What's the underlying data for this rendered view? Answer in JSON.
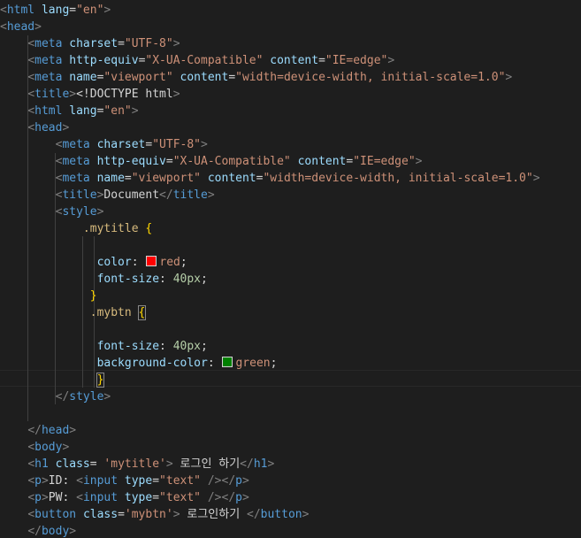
{
  "colors": {
    "swatch_red": "#ff0000",
    "swatch_green": "#008000"
  },
  "lines": [
    [
      [
        "punct",
        "<"
      ],
      [
        "tag",
        "html"
      ],
      [
        "text",
        " "
      ],
      [
        "attr",
        "lang"
      ],
      [
        "text",
        "="
      ],
      [
        "str",
        "\"en\""
      ],
      [
        "punct",
        ">"
      ]
    ],
    [
      [
        "punct",
        "<"
      ],
      [
        "tag",
        "head"
      ],
      [
        "punct",
        ">"
      ]
    ],
    [
      [
        "text",
        "    "
      ],
      [
        "punct",
        "<"
      ],
      [
        "tag",
        "meta"
      ],
      [
        "text",
        " "
      ],
      [
        "attr",
        "charset"
      ],
      [
        "text",
        "="
      ],
      [
        "str",
        "\"UTF-8\""
      ],
      [
        "punct",
        ">"
      ]
    ],
    [
      [
        "text",
        "    "
      ],
      [
        "punct",
        "<"
      ],
      [
        "tag",
        "meta"
      ],
      [
        "text",
        " "
      ],
      [
        "attr",
        "http-equiv"
      ],
      [
        "text",
        "="
      ],
      [
        "str",
        "\"X-UA-Compatible\""
      ],
      [
        "text",
        " "
      ],
      [
        "attr",
        "content"
      ],
      [
        "text",
        "="
      ],
      [
        "str",
        "\"IE=edge\""
      ],
      [
        "punct",
        ">"
      ]
    ],
    [
      [
        "text",
        "    "
      ],
      [
        "punct",
        "<"
      ],
      [
        "tag",
        "meta"
      ],
      [
        "text",
        " "
      ],
      [
        "attr",
        "name"
      ],
      [
        "text",
        "="
      ],
      [
        "str",
        "\"viewport\""
      ],
      [
        "text",
        " "
      ],
      [
        "attr",
        "content"
      ],
      [
        "text",
        "="
      ],
      [
        "str",
        "\"width=device-width, initial-scale=1.0\""
      ],
      [
        "punct",
        ">"
      ]
    ],
    [
      [
        "text",
        "    "
      ],
      [
        "punct",
        "<"
      ],
      [
        "tag",
        "title"
      ],
      [
        "punct",
        ">"
      ],
      [
        "text",
        "<!DOCTYPE html"
      ],
      [
        "punct",
        ">"
      ]
    ],
    [
      [
        "text",
        "    "
      ],
      [
        "punct",
        "<"
      ],
      [
        "tag",
        "html"
      ],
      [
        "text",
        " "
      ],
      [
        "attr",
        "lang"
      ],
      [
        "text",
        "="
      ],
      [
        "str",
        "\"en\""
      ],
      [
        "punct",
        ">"
      ]
    ],
    [
      [
        "text",
        "    "
      ],
      [
        "punct",
        "<"
      ],
      [
        "tag",
        "head"
      ],
      [
        "punct",
        ">"
      ]
    ],
    [
      [
        "text",
        "        "
      ],
      [
        "punct",
        "<"
      ],
      [
        "tag",
        "meta"
      ],
      [
        "text",
        " "
      ],
      [
        "attr",
        "charset"
      ],
      [
        "text",
        "="
      ],
      [
        "str",
        "\"UTF-8\""
      ],
      [
        "punct",
        ">"
      ]
    ],
    [
      [
        "text",
        "        "
      ],
      [
        "punct",
        "<"
      ],
      [
        "tag",
        "meta"
      ],
      [
        "text",
        " "
      ],
      [
        "attr",
        "http-equiv"
      ],
      [
        "text",
        "="
      ],
      [
        "str",
        "\"X-UA-Compatible\""
      ],
      [
        "text",
        " "
      ],
      [
        "attr",
        "content"
      ],
      [
        "text",
        "="
      ],
      [
        "str",
        "\"IE=edge\""
      ],
      [
        "punct",
        ">"
      ]
    ],
    [
      [
        "text",
        "        "
      ],
      [
        "punct",
        "<"
      ],
      [
        "tag",
        "meta"
      ],
      [
        "text",
        " "
      ],
      [
        "attr",
        "name"
      ],
      [
        "text",
        "="
      ],
      [
        "str",
        "\"viewport\""
      ],
      [
        "text",
        " "
      ],
      [
        "attr",
        "content"
      ],
      [
        "text",
        "="
      ],
      [
        "str",
        "\"width=device-width, initial-scale=1.0\""
      ],
      [
        "punct",
        ">"
      ]
    ],
    [
      [
        "text",
        "        "
      ],
      [
        "punct",
        "<"
      ],
      [
        "tag",
        "title"
      ],
      [
        "punct",
        ">"
      ],
      [
        "text",
        "Document"
      ],
      [
        "punct",
        "</"
      ],
      [
        "tag",
        "title"
      ],
      [
        "punct",
        ">"
      ]
    ],
    [
      [
        "text",
        "        "
      ],
      [
        "punct",
        "<"
      ],
      [
        "tag",
        "style"
      ],
      [
        "punct",
        ">"
      ]
    ],
    [
      [
        "text",
        "            "
      ],
      [
        "sel",
        ".mytitle"
      ],
      [
        "text",
        " "
      ],
      [
        "brace",
        "{"
      ]
    ],
    [
      [
        "text",
        ""
      ]
    ],
    [
      [
        "text",
        "              "
      ],
      [
        "prop",
        "color"
      ],
      [
        "text",
        ": "
      ],
      [
        "swatch",
        "swatch_red"
      ],
      [
        "val",
        "red"
      ],
      [
        "text",
        ";"
      ]
    ],
    [
      [
        "text",
        "              "
      ],
      [
        "prop",
        "font-size"
      ],
      [
        "text",
        ": "
      ],
      [
        "num",
        "40px"
      ],
      [
        "text",
        ";"
      ]
    ],
    [
      [
        "text",
        "             "
      ],
      [
        "brace",
        "}"
      ]
    ],
    [
      [
        "text",
        "             "
      ],
      [
        "sel",
        ".mybtn"
      ],
      [
        "text",
        " "
      ],
      [
        "brace_match",
        "{"
      ]
    ],
    [
      [
        "text",
        ""
      ]
    ],
    [
      [
        "text",
        "              "
      ],
      [
        "prop",
        "font-size"
      ],
      [
        "text",
        ": "
      ],
      [
        "num",
        "40px"
      ],
      [
        "text",
        ";"
      ]
    ],
    [
      [
        "text",
        "              "
      ],
      [
        "prop",
        "background-color"
      ],
      [
        "text",
        ": "
      ],
      [
        "swatch",
        "swatch_green"
      ],
      [
        "val",
        "green"
      ],
      [
        "text",
        ";"
      ]
    ],
    [
      [
        "text",
        "              "
      ],
      [
        "brace_match",
        "}"
      ]
    ],
    [
      [
        "text",
        "        "
      ],
      [
        "punct",
        "</"
      ],
      [
        "tag",
        "style"
      ],
      [
        "punct",
        ">"
      ]
    ],
    [
      [
        "text",
        ""
      ]
    ],
    [
      [
        "text",
        "    "
      ],
      [
        "punct",
        "</"
      ],
      [
        "tag",
        "head"
      ],
      [
        "punct",
        ">"
      ]
    ],
    [
      [
        "text",
        "    "
      ],
      [
        "punct",
        "<"
      ],
      [
        "tag",
        "body"
      ],
      [
        "punct",
        ">"
      ]
    ],
    [
      [
        "text",
        "    "
      ],
      [
        "punct",
        "<"
      ],
      [
        "tag",
        "h1"
      ],
      [
        "text",
        " "
      ],
      [
        "attr",
        "class"
      ],
      [
        "text",
        "= "
      ],
      [
        "str",
        "'mytitle'"
      ],
      [
        "punct",
        ">"
      ],
      [
        "text",
        " 로그인 하기"
      ],
      [
        "punct",
        "</"
      ],
      [
        "tag",
        "h1"
      ],
      [
        "punct",
        ">"
      ]
    ],
    [
      [
        "text",
        "    "
      ],
      [
        "punct",
        "<"
      ],
      [
        "tag",
        "p"
      ],
      [
        "punct",
        ">"
      ],
      [
        "text",
        "ID: "
      ],
      [
        "punct",
        "<"
      ],
      [
        "tag",
        "input"
      ],
      [
        "text",
        " "
      ],
      [
        "attr",
        "type"
      ],
      [
        "text",
        "="
      ],
      [
        "str",
        "\"text\""
      ],
      [
        "text",
        " "
      ],
      [
        "punct",
        "/></"
      ],
      [
        "tag",
        "p"
      ],
      [
        "punct",
        ">"
      ]
    ],
    [
      [
        "text",
        "    "
      ],
      [
        "punct",
        "<"
      ],
      [
        "tag",
        "p"
      ],
      [
        "punct",
        ">"
      ],
      [
        "text",
        "PW: "
      ],
      [
        "punct",
        "<"
      ],
      [
        "tag",
        "input"
      ],
      [
        "text",
        " "
      ],
      [
        "attr",
        "type"
      ],
      [
        "text",
        "="
      ],
      [
        "str",
        "\"text\""
      ],
      [
        "text",
        " "
      ],
      [
        "punct",
        "/></"
      ],
      [
        "tag",
        "p"
      ],
      [
        "punct",
        ">"
      ]
    ],
    [
      [
        "text",
        "    "
      ],
      [
        "punct",
        "<"
      ],
      [
        "tag",
        "button"
      ],
      [
        "text",
        " "
      ],
      [
        "attr",
        "class"
      ],
      [
        "text",
        "="
      ],
      [
        "str",
        "'mybtn'"
      ],
      [
        "punct",
        ">"
      ],
      [
        "text",
        " 로그인하기 "
      ],
      [
        "punct",
        "</"
      ],
      [
        "tag",
        "button"
      ],
      [
        "punct",
        ">"
      ]
    ],
    [
      [
        "text",
        "    "
      ],
      [
        "punct",
        "</"
      ],
      [
        "tag",
        "body"
      ],
      [
        "punct",
        ">"
      ]
    ]
  ]
}
